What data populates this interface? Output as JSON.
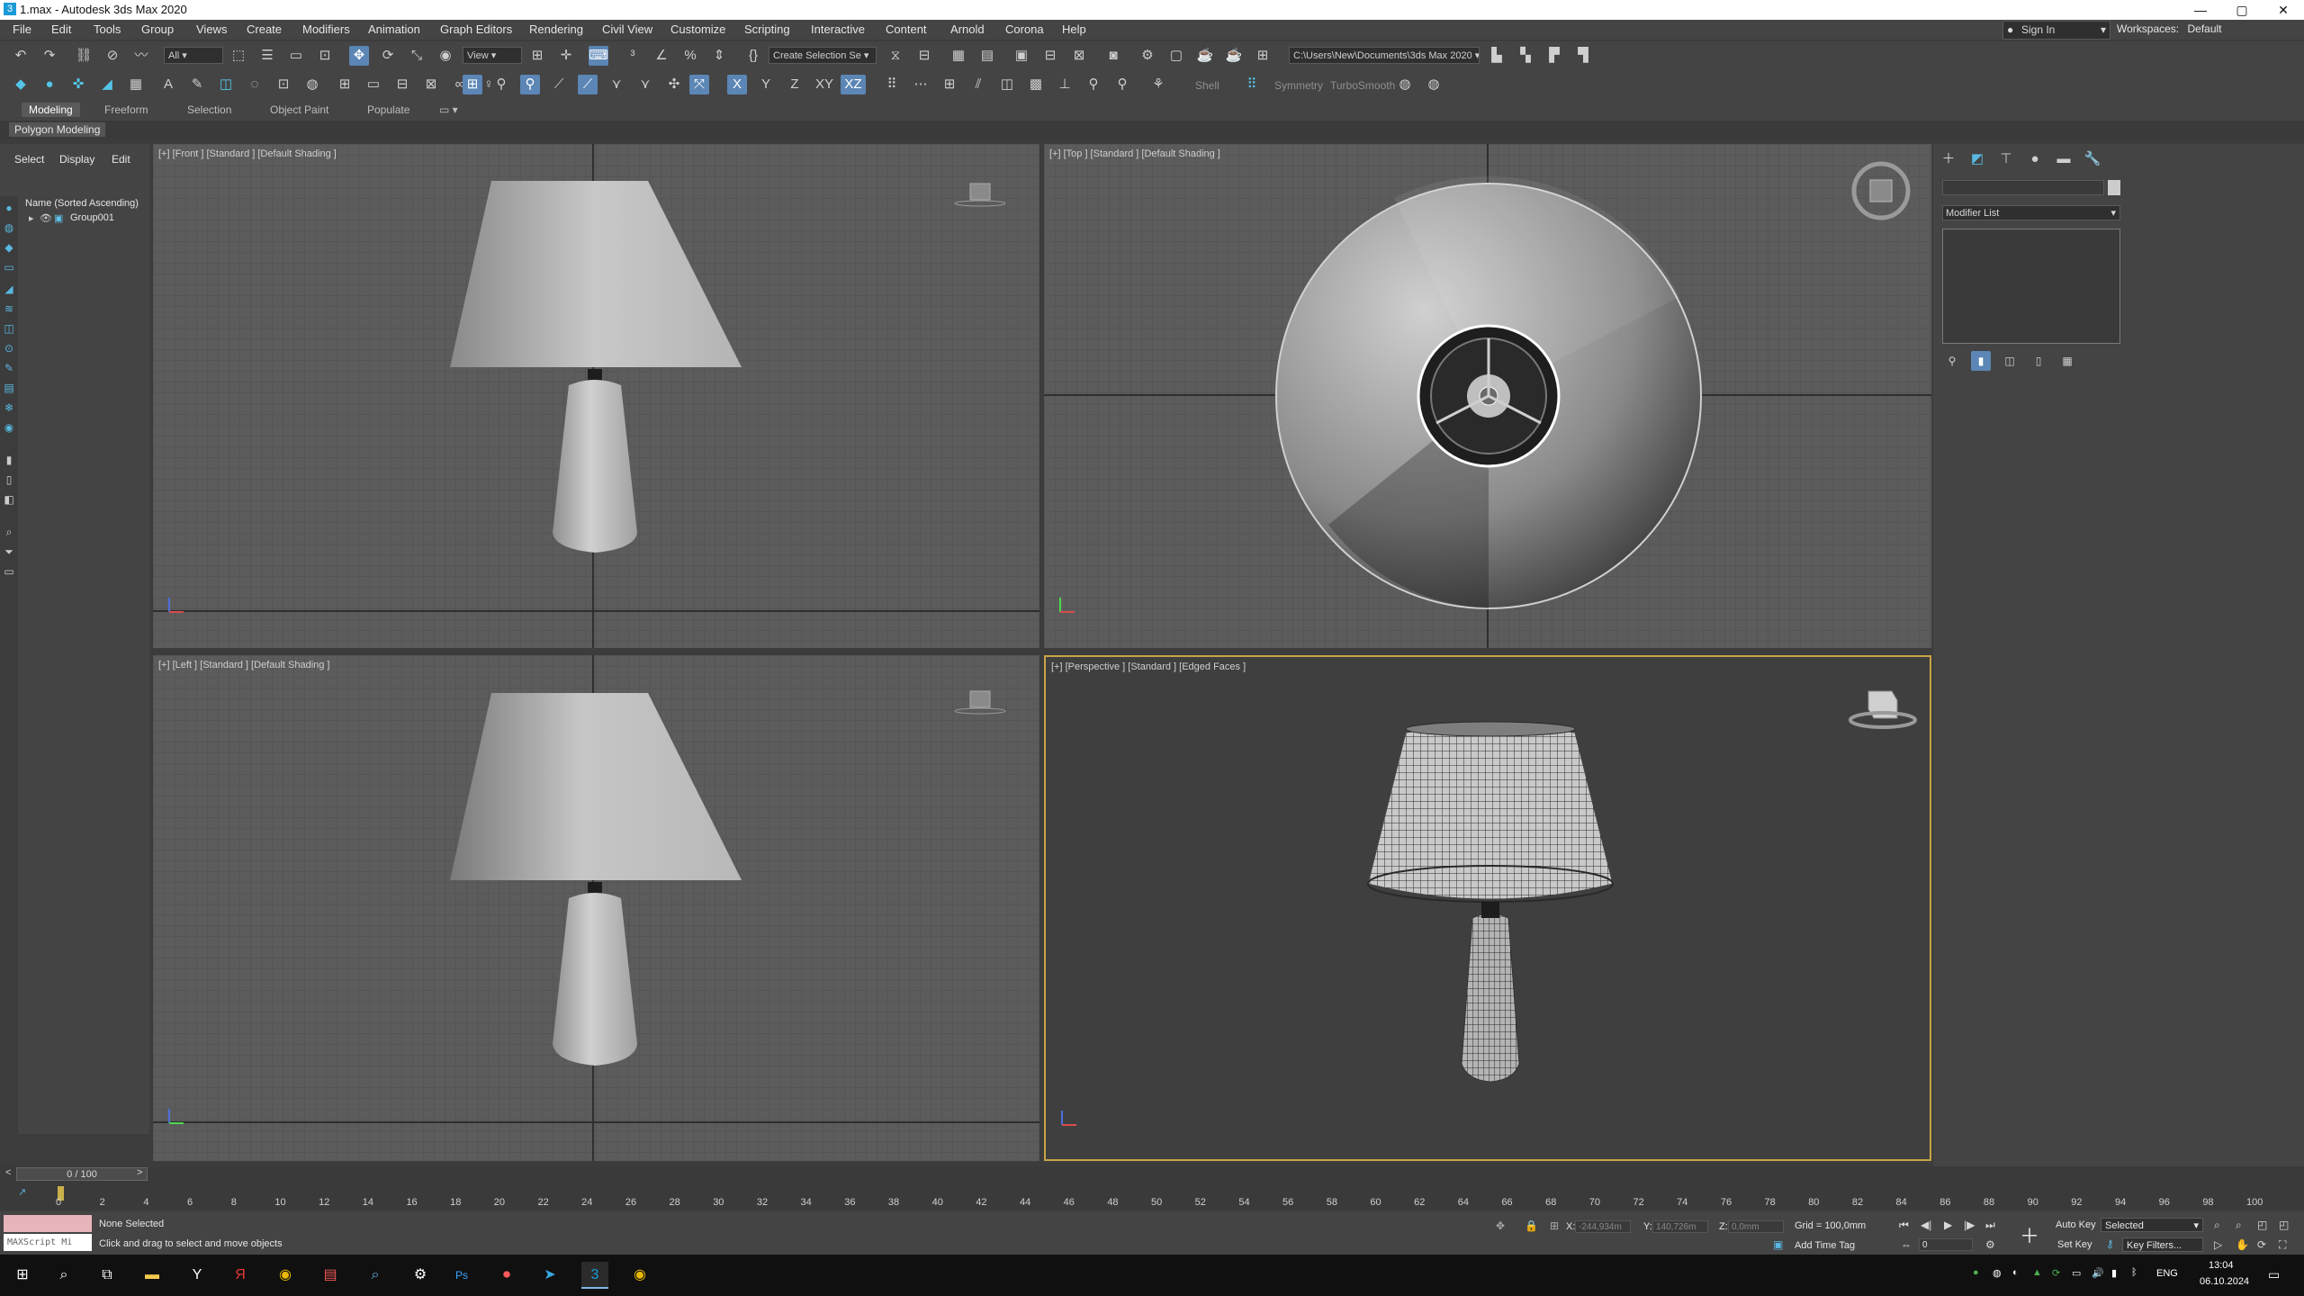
{
  "window": {
    "title": "1.max - Autodesk 3ds Max 2020",
    "app_icon": "3ds-max-icon",
    "controls": {
      "minimize": "—",
      "maximize": "▢",
      "close": "✕"
    }
  },
  "menu": {
    "items": [
      "File",
      "Edit",
      "Tools",
      "Group",
      "Views",
      "Create",
      "Modifiers",
      "Animation",
      "Graph Editors",
      "Rendering",
      "Civil View",
      "Customize",
      "Scripting",
      "Interactive",
      "Content",
      "Arnold",
      "Corona",
      "Help"
    ],
    "sign_in": "Sign In",
    "workspaces_label": "Workspaces:",
    "workspaces_value": "Default"
  },
  "toolbar": {
    "filter_value": "All",
    "ref_coord": "View",
    "selection_set_placeholder": "Create Selection Se",
    "project_path": "C:\\Users\\New\\Documents\\3ds Max 2020",
    "axis_x": "X",
    "axis_y": "Y",
    "axis_z": "Z",
    "axis_xy": "XY",
    "axis_xz": "XZ",
    "shell": "Shell",
    "symmetry": "Symmetry",
    "turbosmooth": "TurboSmooth"
  },
  "ribbon": {
    "tabs": [
      "Modeling",
      "Freeform",
      "Selection",
      "Object Paint",
      "Populate"
    ],
    "active_tab": "Modeling",
    "sub_label": "Polygon Modeling"
  },
  "scene_explorer": {
    "tabs": [
      "Select",
      "Display",
      "Edit"
    ],
    "column_header": "Name (Sorted Ascending)",
    "rows": [
      {
        "name": "Group001"
      }
    ]
  },
  "viewports": {
    "front": "[+] [Front ] [Standard ] [Default Shading ]",
    "top": "[+] [Top ] [Standard ] [Default Shading ]",
    "left": "[+] [Left ] [Standard ] [Default Shading ]",
    "perspective": "[+] [Perspective ] [Standard ] [Edged Faces ]"
  },
  "command_panel": {
    "modifier_list": "Modifier List"
  },
  "time": {
    "frame_display": "0 / 100",
    "ticks": [
      "0",
      "2",
      "4",
      "6",
      "8",
      "10",
      "12",
      "14",
      "16",
      "18",
      "20",
      "22",
      "24",
      "26",
      "28",
      "30",
      "32",
      "34",
      "36",
      "38",
      "40",
      "42",
      "44",
      "46",
      "48",
      "50",
      "52",
      "54",
      "56",
      "58",
      "60",
      "62",
      "64",
      "66",
      "68",
      "70",
      "72",
      "74",
      "76",
      "78",
      "80",
      "82",
      "84",
      "86",
      "88",
      "90",
      "92",
      "94",
      "96",
      "98",
      "100"
    ]
  },
  "status": {
    "maxscript_placeholder": "MAXScript Mi",
    "selection": "None Selected",
    "prompt": "Click and drag to select and move objects",
    "x_label": "X:",
    "x_value": "-244,934m",
    "y_label": "Y:",
    "y_value": "140,726m",
    "z_label": "Z:",
    "z_value": "0,0mm",
    "grid": "Grid = 100,0mm",
    "add_time_tag": "Add Time Tag",
    "auto_key": "Auto Key",
    "set_key": "Set Key",
    "selected": "Selected",
    "key_filters": "Key Filters...",
    "frame_field": "0"
  },
  "taskbar": {
    "lang": "ENG",
    "time": "13:04",
    "date": "06.10.2024"
  },
  "colors": {
    "active_viewport_border": "#c7a545",
    "toolbar_active": "#5b86b5",
    "maxscript_pink": "#e6b4b9"
  }
}
